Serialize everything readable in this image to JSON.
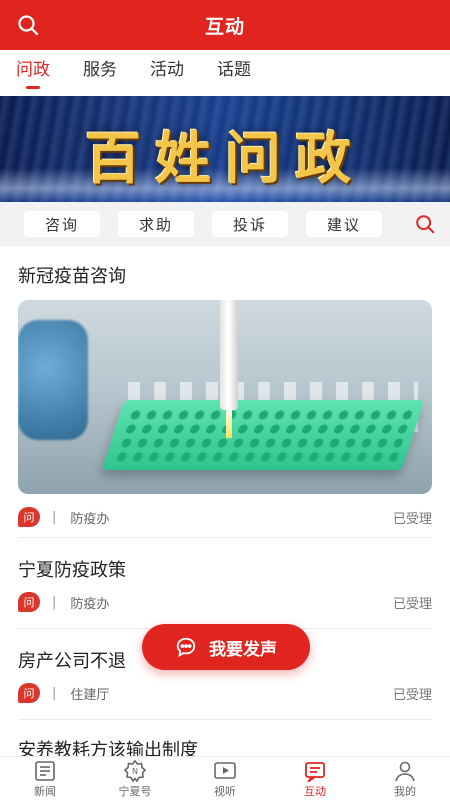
{
  "header": {
    "title": "互动",
    "search_icon": "search-icon"
  },
  "tabs": [
    {
      "label": "问政",
      "active": true
    },
    {
      "label": "服务",
      "active": false
    },
    {
      "label": "活动",
      "active": false
    },
    {
      "label": "话题",
      "active": false
    }
  ],
  "banner": {
    "title": "百姓问政"
  },
  "subnav": {
    "pills": [
      "咨询",
      "求助",
      "投诉",
      "建议"
    ],
    "search_icon": "search-icon"
  },
  "feed": [
    {
      "title": "新冠疫苗咨询",
      "badge": "问",
      "department": "防疫办",
      "status": "已受理",
      "has_image": true
    },
    {
      "title": "宁夏防疫政策",
      "badge": "问",
      "department": "防疫办",
      "status": "已受理"
    },
    {
      "title": "房产公司不退",
      "badge": "问",
      "department": "住建厅",
      "status": "已受理"
    },
    {
      "title": "安养教耗方该输出制度"
    }
  ],
  "fab": {
    "label": "我要发声",
    "icon": "chat-bubble-icon"
  },
  "bottom_nav": [
    {
      "label": "新闻",
      "icon": "news-icon",
      "active": false
    },
    {
      "label": "宁夏号",
      "icon": "ningxia-badge-icon",
      "active": false
    },
    {
      "label": "视听",
      "icon": "video-icon",
      "active": false
    },
    {
      "label": "互动",
      "icon": "interact-icon",
      "active": true
    },
    {
      "label": "我的",
      "icon": "profile-icon",
      "active": false
    }
  ],
  "colors": {
    "brand": "#e02520",
    "badge": "#d9372d",
    "subnav_bg": "#f2f2f2"
  }
}
